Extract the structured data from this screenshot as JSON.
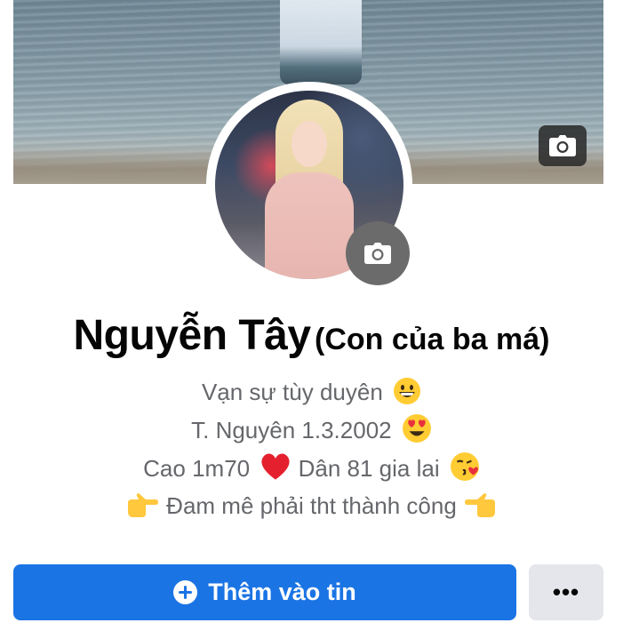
{
  "profile": {
    "name": "Nguyễn Tây",
    "nickname": "(Con của ba má)",
    "cover_camera_icon": "camera-icon",
    "avatar_camera_icon": "camera-icon"
  },
  "bio": {
    "lines": [
      {
        "text": "Vạn sự tùy duyên",
        "emoji": "grinning-face"
      },
      {
        "text": "T. Nguyên 1.3.2002",
        "emoji": "heart-eyes-face"
      },
      {
        "text": "Cao 1m70",
        "mid_emoji": "red-heart",
        "text2": "Dân 81 gia lai",
        "emoji": "face-blowing-kiss"
      },
      {
        "text": "Đam mê phải tht thành công",
        "lead_emoji": "pointing-right",
        "emoji": "pointing-left"
      }
    ]
  },
  "actions": {
    "add_story_label": "Thêm vào tin",
    "add_story_icon": "plus-circle-icon",
    "more_label": "•••"
  },
  "colors": {
    "primary": "#1b74e4",
    "secondary_button": "#e4e6eb",
    "bio_text": "#65676b"
  }
}
